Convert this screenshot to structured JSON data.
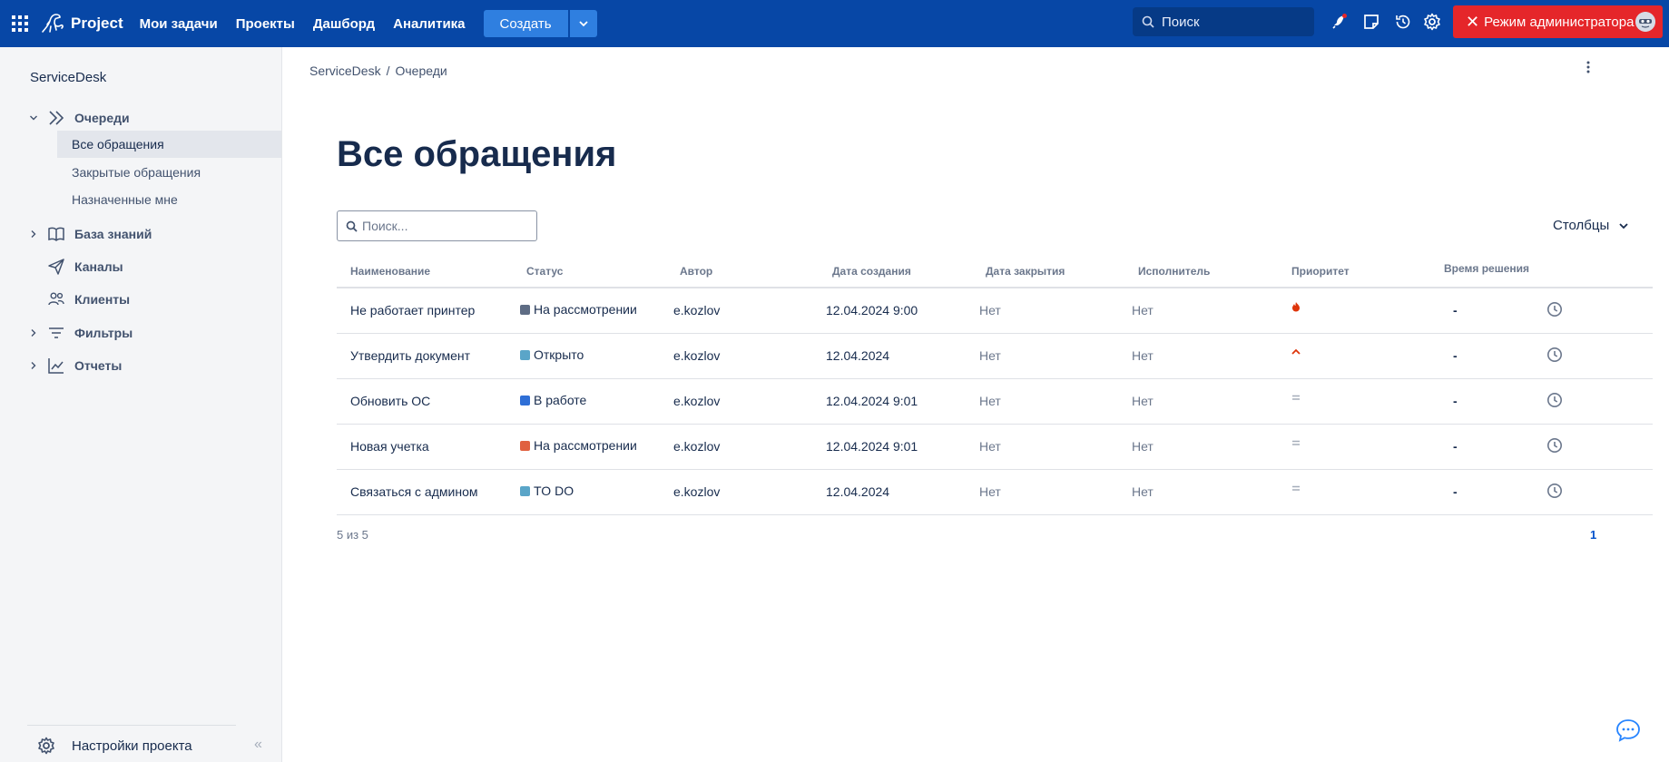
{
  "topbar": {
    "app_name": "Project",
    "nav": [
      "Мои задачи",
      "Проекты",
      "Дашборд",
      "Аналитика"
    ],
    "create_label": "Создать",
    "search_placeholder": "Поиск",
    "admin_label": "Режим администратора",
    "colors": {
      "bar": "#0747a6",
      "create": "#2f7fe0",
      "admin": "#e5262a"
    }
  },
  "sidebar": {
    "title": "ServiceDesk",
    "queues_label": "Очереди",
    "queue_items": [
      "Все обращения",
      "Закрытые обращения",
      "Назначенные мне"
    ],
    "sections": [
      "База знаний",
      "Каналы",
      "Клиенты",
      "Фильтры",
      "Отчеты"
    ],
    "settings_label": "Настройки проекта",
    "collapse_glyph": "«"
  },
  "main": {
    "breadcrumb": [
      "ServiceDesk",
      "Очереди"
    ],
    "breadcrumb_sep": "/",
    "title": "Все обращения",
    "search_placeholder": "Поиск...",
    "columns_label": "Столбцы",
    "headers": [
      "Наименование",
      "Статус",
      "Автор",
      "Дата создания",
      "Дата закрытия",
      "Исполнитель",
      "Приоритет",
      "Время решения"
    ],
    "rows": [
      {
        "name": "Не работает принтер",
        "status": "На рассмотрении",
        "status_color": "#5e6c84",
        "author": "e.kozlov",
        "created": "12.04.2024 9:00",
        "closed": "Нет",
        "assignee": "Нет",
        "priority": "highest",
        "resolution": "-"
      },
      {
        "name": "Утвердить документ",
        "status": "Открыто",
        "status_color": "#5aa5c8",
        "author": "e.kozlov",
        "created": "12.04.2024",
        "closed": "Нет",
        "assignee": "Нет",
        "priority": "high",
        "resolution": "-"
      },
      {
        "name": "Обновить ОС",
        "status": "В работе",
        "status_color": "#2f6fd6",
        "author": "e.kozlov",
        "created": "12.04.2024 9:01",
        "closed": "Нет",
        "assignee": "Нет",
        "priority": "medium",
        "resolution": "-"
      },
      {
        "name": "Новая учетка",
        "status": "На рассмотрении",
        "status_color": "#e0603f",
        "author": "e.kozlov",
        "created": "12.04.2024 9:01",
        "closed": "Нет",
        "assignee": "Нет",
        "priority": "medium",
        "resolution": "-"
      },
      {
        "name": "Связаться с админом",
        "status": "TO DO",
        "status_color": "#5aa5c8",
        "author": "e.kozlov",
        "created": "12.04.2024",
        "closed": "Нет",
        "assignee": "Нет",
        "priority": "medium",
        "resolution": "-"
      }
    ],
    "count_text": "5 из 5",
    "page": "1"
  }
}
